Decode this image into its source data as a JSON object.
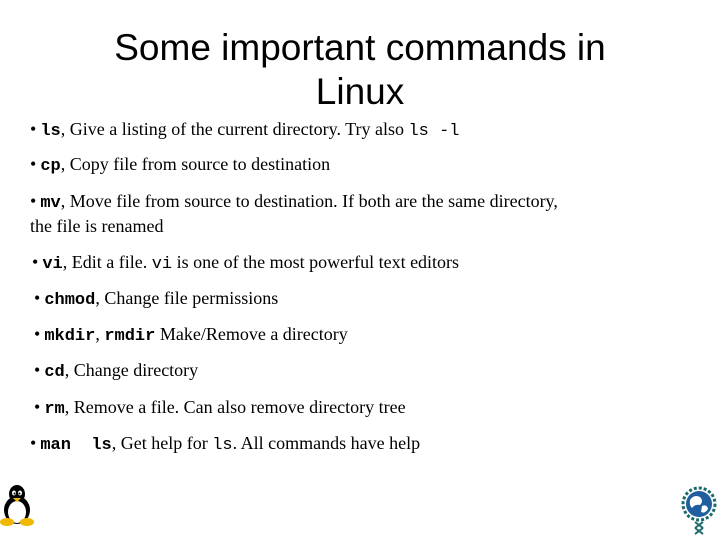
{
  "title": {
    "line1": "Some important commands in",
    "line2": "Linux"
  },
  "bullets": [
    {
      "cmd": "ls",
      "sep": ", ",
      "text": "Give a listing of the current directory. Try also ",
      "code": "ls -l",
      "tail": ""
    },
    {
      "cmd": "cp",
      "sep": ", ",
      "text": "Copy file from source to destination"
    },
    {
      "cmd": "mv",
      "sep": ", ",
      "text": "Move file from source to destination. If both are the same directory,",
      "line2": "the file is renamed"
    },
    {
      "cmd": "vi",
      "sep": ", ",
      "text": "Edit a file. ",
      "code": "vi",
      "tail": " is one of the most powerful text editors"
    },
    {
      "cmd": "chmod",
      "sep": ", ",
      "text": "Change file permissions"
    },
    {
      "cmd": "mkdir",
      "sep": ", ",
      "cmd2": "rmdir",
      "text": " Make/Remove a directory"
    },
    {
      "cmd": "cd",
      "sep": ", ",
      "text": "Change directory"
    },
    {
      "cmd": "rm",
      "sep": ", ",
      "text": "Remove a file. Can also remove directory tree"
    },
    {
      "cmd": "man  ls",
      "sep": ", ",
      "text": "Get help for ",
      "code": "ls",
      "tail": ". All commands have help"
    }
  ],
  "bullet_glyph": "•",
  "logos": {
    "left": "linux-tux-penguin",
    "right": "globe-emblem"
  }
}
